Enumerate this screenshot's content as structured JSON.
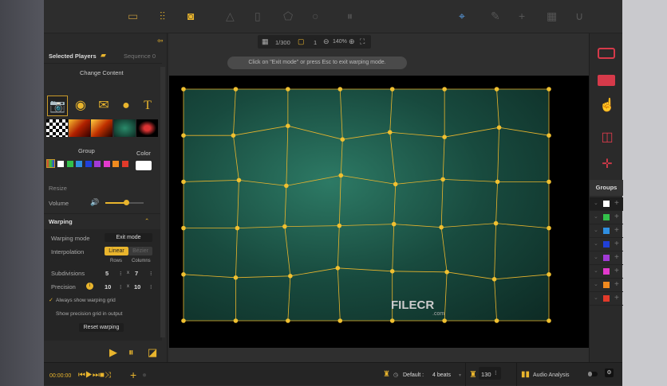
{
  "toolbar": {
    "left_icons": [
      "screen-icon",
      "mixer-icon",
      "projector-icon"
    ],
    "middle_icons": [
      "triangle-icon",
      "tablet-icon",
      "shape-icon",
      "circle-icon",
      "pause-icon"
    ],
    "right_icons": [
      "crosshair-icon",
      "pen-icon",
      "plus-icon",
      "grid-icon",
      "magnet-icon"
    ]
  },
  "left_panel": {
    "title": "Selected Players",
    "sequence": "Sequence 0",
    "change_content": "Change Content",
    "group_label": "Group",
    "color_label": "Color",
    "group_colors": [
      "#ffffff",
      "#33c04a",
      "#2f8fe0",
      "#2040d8",
      "#a23ad6",
      "#e23acd",
      "#f08a1f",
      "#e23a2a"
    ],
    "selected_color": "#ffffff",
    "resize": "Resize",
    "volume": "Volume",
    "volume_level": 0.55,
    "warping": {
      "title": "Warping",
      "mode_label": "Warping mode",
      "mode_button": "Exit mode",
      "interpolation_label": "Interpolation",
      "interp_options": [
        "Linear",
        "Bézier"
      ],
      "interp_selected": "Linear",
      "rows": "Rows",
      "columns": "Columns",
      "subdivisions_label": "Subdivisions",
      "sub_rows": "5",
      "sub_x": "x",
      "sub_cols": "7",
      "precision_label": "Precision",
      "prec_rows": "10",
      "prec_cols": "10",
      "always_show": "Always show warping grid",
      "show_precision": "Show precision grid in output",
      "reset": "Reset warping"
    }
  },
  "view_bar": {
    "frame": "1/300",
    "layer": "1",
    "zoom": "140%"
  },
  "hint": "Click on \"Exit mode\" or press Esc to exit warping mode.",
  "watermark": {
    "brand": "FILECR",
    "suffix": ".com"
  },
  "right_panel": {
    "groups_title": "Groups",
    "group_colors": [
      "#ffffff",
      "#33c04a",
      "#2f8fe0",
      "#2040d8",
      "#a23ad6",
      "#e23acd",
      "#f08a1f",
      "#e23a2a"
    ]
  },
  "bottom": {
    "time": "00:00:00",
    "tempo_label": "Default :",
    "beats": "4 beats",
    "bpm": "130",
    "audio": "Audio Analysis"
  },
  "colors": {
    "accent": "#e9b52d",
    "danger": "#d63a4a"
  }
}
